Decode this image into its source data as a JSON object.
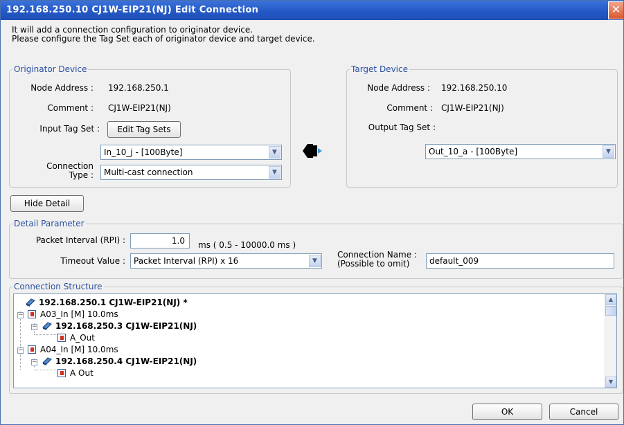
{
  "window": {
    "title": "192.168.250.10 CJ1W-EIP21(NJ) Edit Connection",
    "close_glyph": "✕"
  },
  "intro": {
    "line1": "It will add a connection configuration to originator device.",
    "line2": "Please configure the Tag Set each of originator device and target device."
  },
  "originator": {
    "legend": "Originator Device",
    "node_address_label": "Node Address :",
    "node_address": "192.168.250.1",
    "comment_label": "Comment :",
    "comment": "CJ1W-EIP21(NJ)",
    "input_tag_set_label": "Input Tag Set :",
    "edit_tag_sets_button": "Edit Tag Sets",
    "tag_set_value": "In_10_j - [100Byte]",
    "connection_type_label_1": "Connection",
    "connection_type_label_2": "Type :",
    "connection_type_value": "Multi-cast connection"
  },
  "target": {
    "legend": "Target Device",
    "node_address_label": "Node Address :",
    "node_address": "192.168.250.10",
    "comment_label": "Comment :",
    "comment": "CJ1W-EIP21(NJ)",
    "output_tag_set_label": "Output Tag Set :",
    "tag_set_value": "Out_10_a - [100Byte]"
  },
  "hide_detail_button": "Hide Detail",
  "detail": {
    "legend": "Detail Parameter",
    "rpi_label": "Packet Interval (RPI) :",
    "rpi_value": "1.0",
    "rpi_range": "ms ( 0.5 - 10000.0 ms )",
    "timeout_label": "Timeout Value :",
    "timeout_value": "Packet Interval (RPI) x 16",
    "conn_name_label_1": "Connection Name :",
    "conn_name_label_2": "(Possible to omit)",
    "conn_name_value": "default_009"
  },
  "structure": {
    "legend": "Connection Structure",
    "rows": [
      {
        "text": "192.168.250.1 CJ1W-EIP21(NJ) *"
      },
      {
        "text": "A03_In [M] 10.0ms"
      },
      {
        "text": "192.168.250.3 CJ1W-EIP21(NJ)"
      },
      {
        "text": "A_Out"
      },
      {
        "text": "A04_In [M] 10.0ms"
      },
      {
        "text": "192.168.250.4 CJ1W-EIP21(NJ)"
      },
      {
        "text": "A Out"
      }
    ],
    "expand_glyph": "−"
  },
  "buttons": {
    "ok": "OK",
    "cancel": "Cancel"
  },
  "icons": {
    "close": "close-icon",
    "dropdown": "chevron-down-icon",
    "connection": "connection-arrow-icon",
    "device": "device-icon",
    "tag": "tag-icon",
    "scroll_up": "scroll-up-icon",
    "scroll_down": "scroll-down-icon"
  },
  "colors": {
    "titlebar": "#2357c4",
    "legend_text": "#2a4fa0",
    "tag_icon": "#d0301e"
  }
}
